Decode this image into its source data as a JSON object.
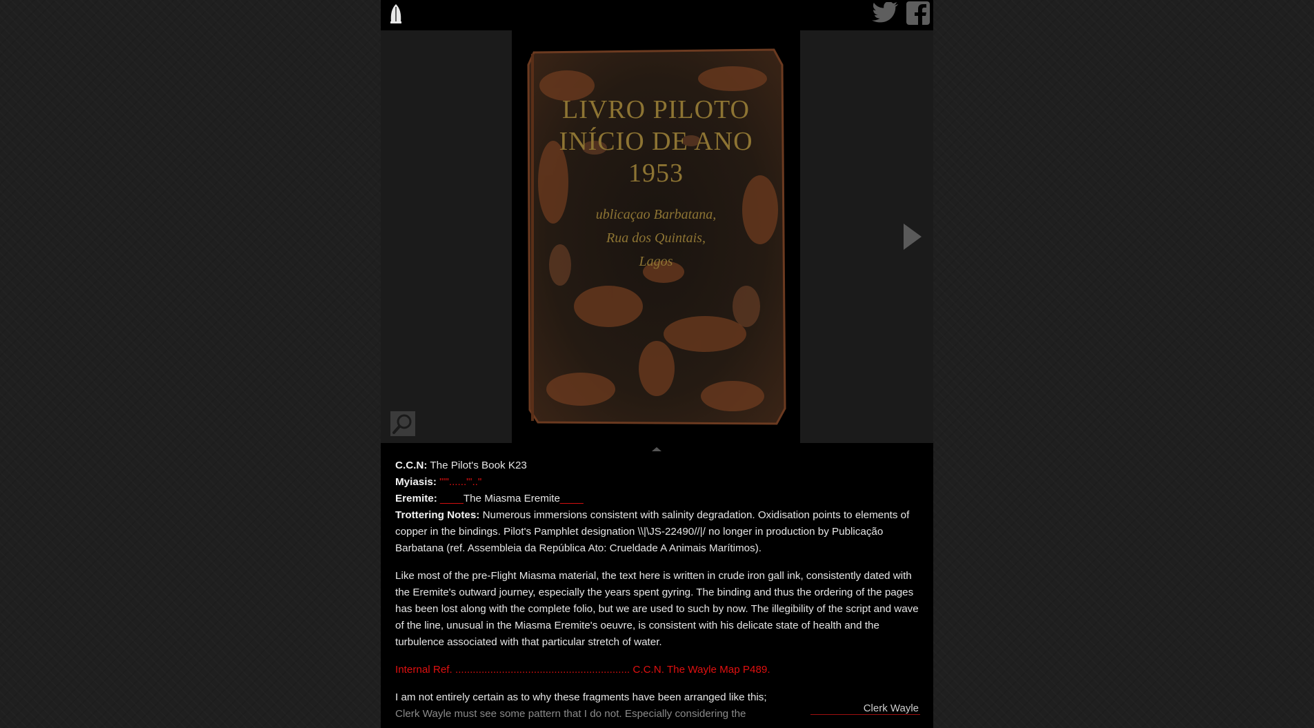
{
  "header": {
    "logo_icon": "quill-logo-icon",
    "social": [
      "twitter-icon",
      "facebook-icon"
    ]
  },
  "viewer": {
    "book_title_lines": [
      "LIVRO PILOTO",
      "INÍCIO DE ANO",
      "1953"
    ],
    "book_subtitle_lines": [
      "ublicaçao Barbatana,",
      "Rua dos Quintais,",
      "Lagos"
    ],
    "next_icon": "play-right-icon",
    "zoom_icon": "magnifier-icon",
    "collapse_icon": "caret-up-icon"
  },
  "details": {
    "ccn_label": "C.C.N:",
    "ccn_value": "The Pilot's Book K23",
    "myiasis_label": "Myiasis:",
    "myiasis_value": "\"\"'......\"'..\"",
    "eremite_label": "Eremite:",
    "eremite_prefix": "____",
    "eremite_value": "The Miasma Eremite",
    "eremite_suffix": "____",
    "trottering_label": "Trottering Notes:",
    "trottering_value": "Numerous immersions consistent with salinity degradation. Oxidisation points to elements of copper in the bindings. Pilot's Pamphlet designation \\\\|\\JS-22490//|/ no longer in production by Publicação Barbatana (ref. Assembleia da República Ato: Crueldade A Animais Marítimos)."
  },
  "body": {
    "paragraph": "Like most of the pre-Flight Miasma material, the text here is written in crude iron gall ink, consistently dated with the Eremite's outward journey, especially the years spent gyring. The binding and thus the ordering of the pages has been lost along with the complete folio, but we are used to such by now. The illegibility of the script and wave of the line, unusual in the Miasma Eremite's oeuvre, is consistent with his delicate state of health and the turbulence associated with that particular stretch of water.",
    "internal_ref_label": "Internal Ref.",
    "internal_ref_dots": "............................................................",
    "internal_ref_target": "C.C.N. The Wayle Map P489.",
    "note_line1": "I am not entirely certain as to why these fragments have been arranged like this;",
    "note_line2": "Clerk Wayle must see some pattern that I do not. Especially considering the",
    "signature": "Clerk Wayle"
  },
  "colors": {
    "page_bg": "#000000",
    "outer_bg": "#1f1f1f",
    "text": "#e6e6e6",
    "accent_red": "#e01010",
    "book_gold": "#8d7433"
  }
}
